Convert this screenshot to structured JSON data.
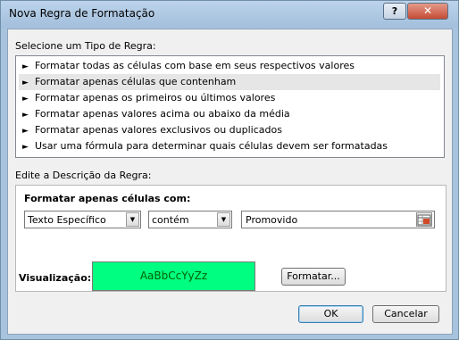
{
  "window": {
    "title": "Nova Regra de Formatação",
    "help_label": "?",
    "close_label": "✕"
  },
  "rule_type": {
    "heading": "Selecione um Tipo de Regra:",
    "items": [
      {
        "label": "Formatar todas as células com base em seus respectivos valores"
      },
      {
        "label": "Formatar apenas células que contenham"
      },
      {
        "label": "Formatar apenas os primeiros ou últimos valores"
      },
      {
        "label": "Formatar apenas valores acima ou abaixo da média"
      },
      {
        "label": "Formatar apenas valores exclusivos ou duplicados"
      },
      {
        "label": "Usar uma fórmula para determinar quais células devem ser formatadas"
      }
    ],
    "selected_index": 1
  },
  "description": {
    "heading": "Edite a Descrição da Regra:",
    "subheading": "Formatar apenas células com:",
    "condition_type": "Texto Específico",
    "operator": "contém",
    "value": "Promovido"
  },
  "preview": {
    "label": "Visualização:",
    "sample_text": "AaBbCcYyZz",
    "background_color": "#00ff80",
    "text_color": "#006100"
  },
  "buttons": {
    "format": "Formatar...",
    "ok": "OK",
    "cancel": "Cancelar"
  }
}
